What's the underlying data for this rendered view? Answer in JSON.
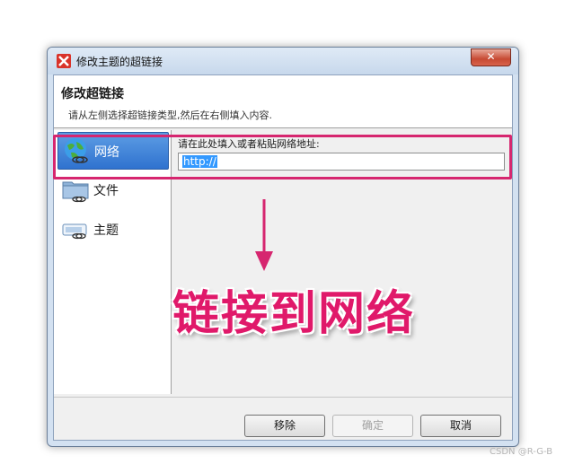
{
  "window": {
    "title": "修改主题的超链接",
    "close_label": "✕"
  },
  "header": {
    "title": "修改超链接",
    "description": "请从左侧选择超链接类型,然后在右侧填入内容."
  },
  "sidebar": {
    "items": [
      {
        "label": "网络",
        "icon": "globe-link-icon",
        "selected": true
      },
      {
        "label": "文件",
        "icon": "folder-link-icon",
        "selected": false
      },
      {
        "label": "主题",
        "icon": "topic-link-icon",
        "selected": false
      }
    ]
  },
  "form": {
    "label": "请在此处填入或者粘贴网络地址:",
    "url_value": "http://"
  },
  "buttons": {
    "remove": "移除",
    "ok": "确定",
    "cancel": "取消"
  },
  "annotation": {
    "text": "链接到网络",
    "color": "#e0196a"
  },
  "watermark": "CSDN @R-G-B",
  "colors": {
    "highlight": "#d6266f",
    "selected": "#2f72cf"
  }
}
